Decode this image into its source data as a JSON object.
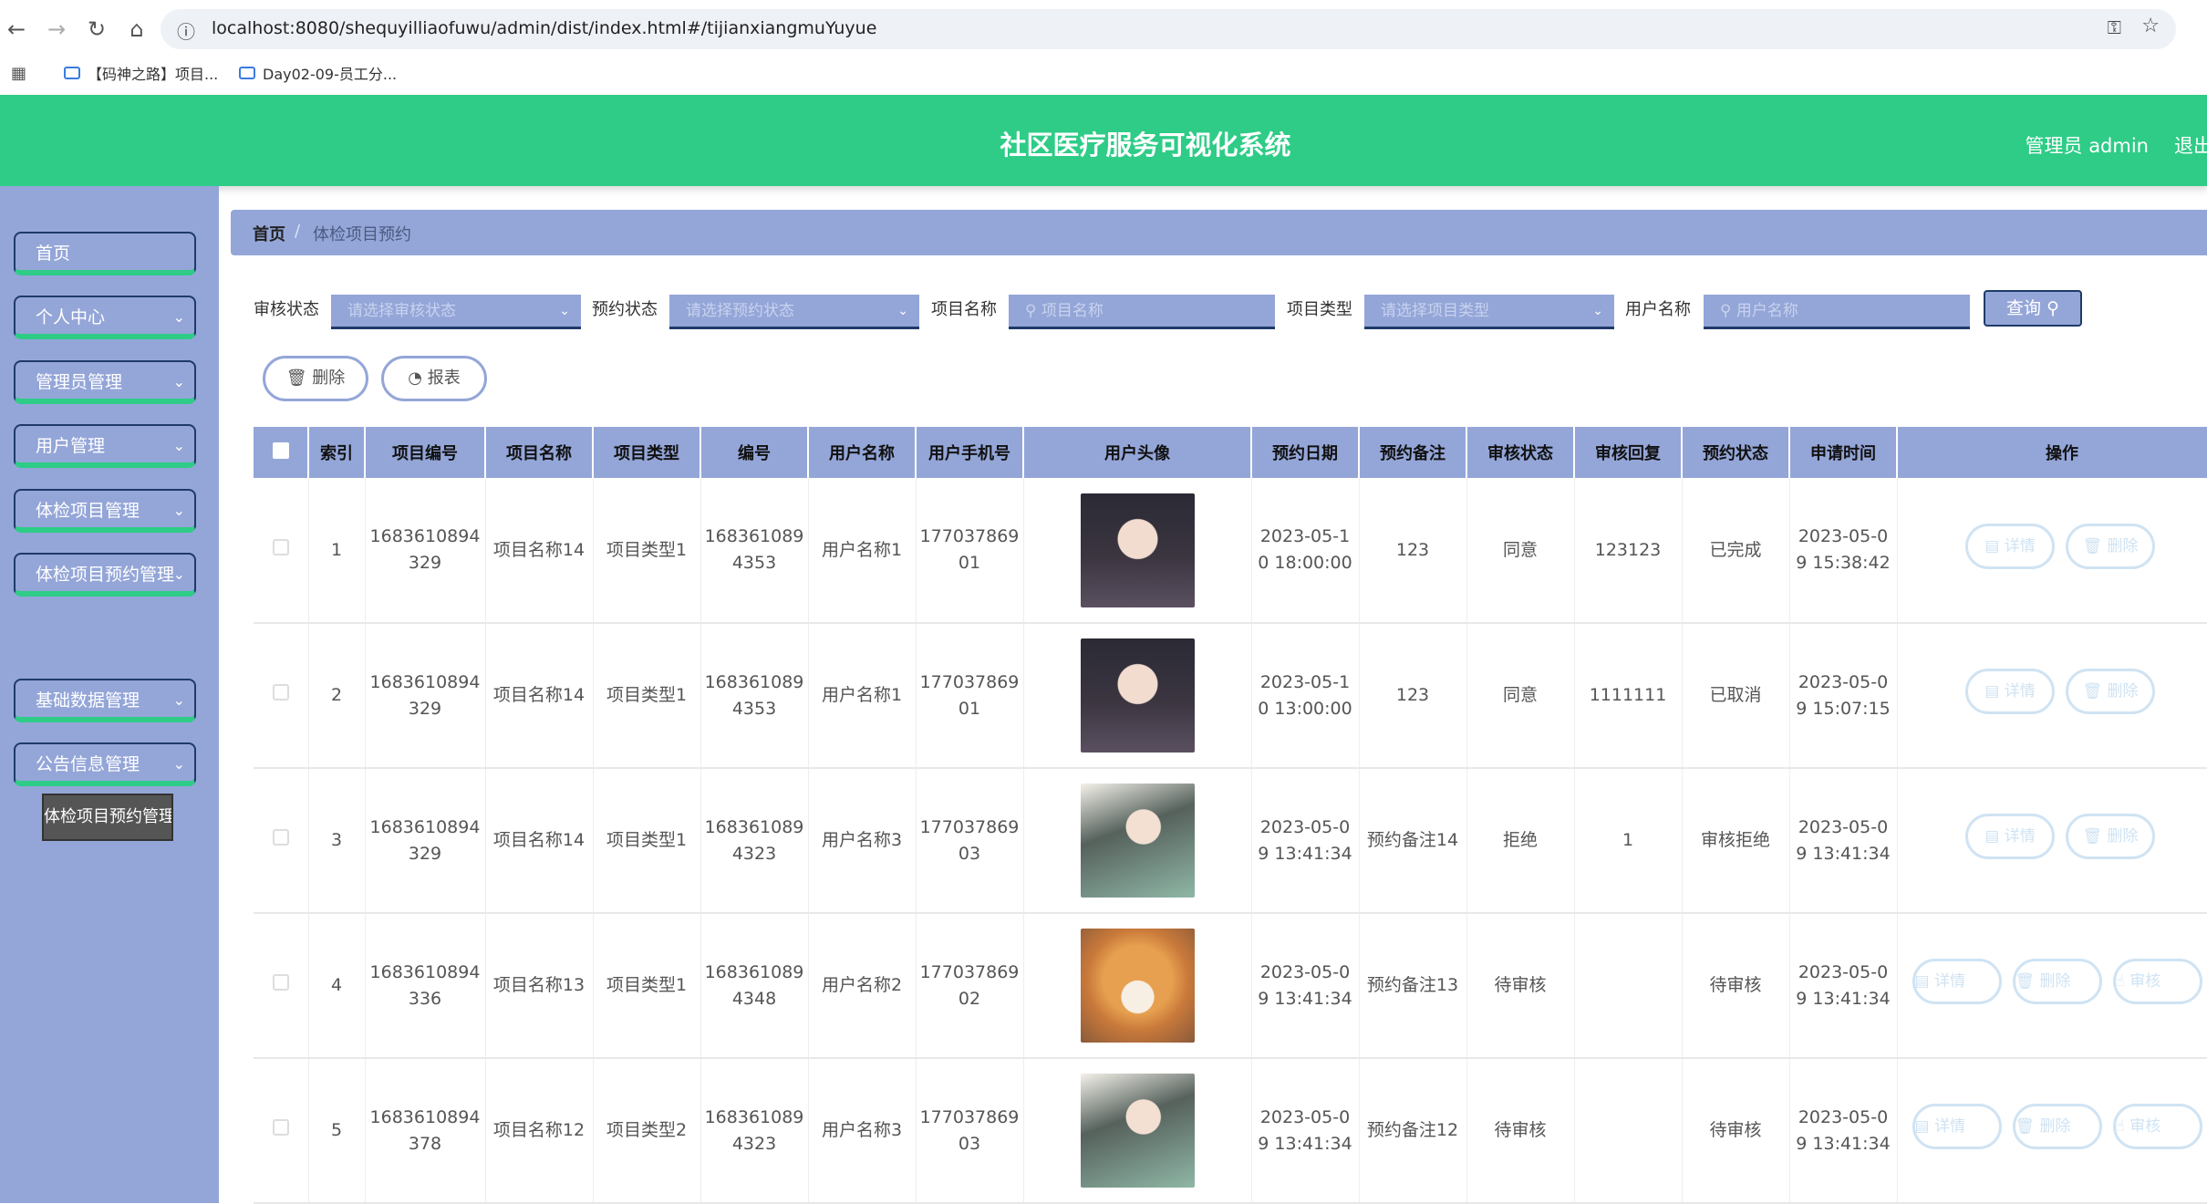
{
  "browser": {
    "url": "localhost:8080/shequyilliaofuwu/admin/dist/index.html#/tijianxiangmuYuyue",
    "bookmarks": [
      "【码神之路】项目...",
      "Day02-09-员工分..."
    ]
  },
  "header": {
    "title": "社区医疗服务可视化系统",
    "user": "管理员 admin",
    "logout": "退出"
  },
  "sidebar": {
    "items": [
      "首页",
      "个人中心",
      "管理员管理",
      "用户管理",
      "体检项目管理",
      "体检项目预约管理",
      "基础数据管理",
      "公告信息管理"
    ],
    "sub_item": "体检项目预约管理"
  },
  "breadcrumb": {
    "home": "首页",
    "sep": "/",
    "current": "体检项目预约"
  },
  "filters": {
    "audit_label": "审核状态",
    "audit_placeholder": "请选择审核状态",
    "booking_label": "预约状态",
    "booking_placeholder": "请选择预约状态",
    "name_label": "项目名称",
    "name_placeholder": "项目名称",
    "type_label": "项目类型",
    "type_placeholder": "请选择项目类型",
    "user_label": "用户名称",
    "user_placeholder": "用户名称",
    "query_label": "查询"
  },
  "actions": {
    "delete": "删除",
    "report": "报表"
  },
  "table": {
    "headers": [
      "索引",
      "项目编号",
      "项目名称",
      "项目类型",
      "编号",
      "用户名称",
      "用户手机号",
      "用户头像",
      "预约日期",
      "预约备注",
      "审核状态",
      "审核回复",
      "预约状态",
      "申请时间",
      "操作"
    ],
    "rows": [
      {
        "idx": "1",
        "code": "1683610894329",
        "name": "项目名称14",
        "type": "项目类型1",
        "no": "1683610894353",
        "user": "用户名称1",
        "phone": "17703786901",
        "avatar": "girl",
        "date": "2023-05-10 18:00:00",
        "note": "123",
        "audit": "同意",
        "reply": "123123",
        "status": "已完成",
        "applied": "2023-05-09 15:38:42",
        "ops": [
          "详情",
          "删除"
        ]
      },
      {
        "idx": "2",
        "code": "1683610894329",
        "name": "项目名称14",
        "type": "项目类型1",
        "no": "1683610894353",
        "user": "用户名称1",
        "phone": "17703786901",
        "avatar": "girl",
        "date": "2023-05-10 13:00:00",
        "note": "123",
        "audit": "同意",
        "reply": "1111111",
        "status": "已取消",
        "applied": "2023-05-09 15:07:15",
        "ops": [
          "详情",
          "删除"
        ]
      },
      {
        "idx": "3",
        "code": "1683610894329",
        "name": "项目名称14",
        "type": "项目类型1",
        "no": "1683610894323",
        "user": "用户名称3",
        "phone": "17703786903",
        "avatar": "anime",
        "date": "2023-05-09 13:41:34",
        "note": "预约备注14",
        "audit": "拒绝",
        "reply": "1",
        "status": "审核拒绝",
        "applied": "2023-05-09 13:41:34",
        "ops": [
          "详情",
          "删除"
        ]
      },
      {
        "idx": "4",
        "code": "1683610894336",
        "name": "项目名称13",
        "type": "项目类型1",
        "no": "1683610894348",
        "user": "用户名称2",
        "phone": "17703786902",
        "avatar": "dog",
        "date": "2023-05-09 13:41:34",
        "note": "预约备注13",
        "audit": "待审核",
        "reply": "",
        "status": "待审核",
        "applied": "2023-05-09 13:41:34",
        "ops": [
          "详情",
          "删除",
          "审核"
        ]
      },
      {
        "idx": "5",
        "code": "1683610894378",
        "name": "项目名称12",
        "type": "项目类型2",
        "no": "1683610894323",
        "user": "用户名称3",
        "phone": "17703786903",
        "avatar": "anime",
        "date": "2023-05-09 13:41:34",
        "note": "预约备注12",
        "audit": "待审核",
        "reply": "",
        "status": "待审核",
        "applied": "2023-05-09 13:41:34",
        "ops": [
          "详情",
          "删除",
          "审核"
        ]
      }
    ]
  }
}
